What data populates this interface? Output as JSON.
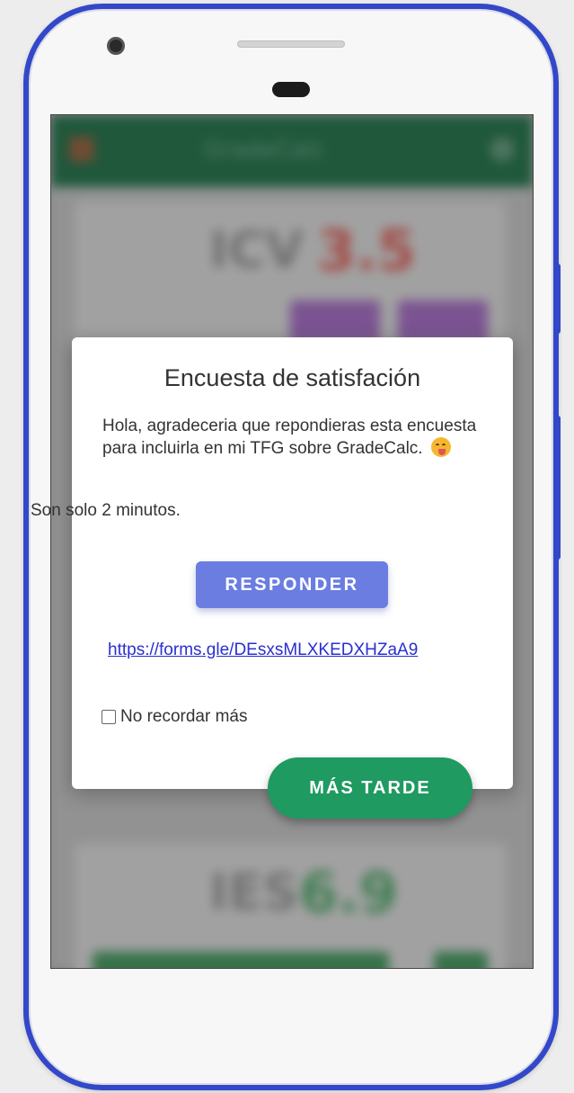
{
  "app": {
    "title": "GradeCalc",
    "card1": {
      "label": "ICV",
      "value": "3.5"
    },
    "card2": {
      "label": "IES",
      "value": "6.9"
    }
  },
  "dialog": {
    "title": "Encuesta de satisfación",
    "body": "Hola, agradeceria que repondieras esta encuesta para incluirla en mi TFG sobre GradeCalc.",
    "emoji": "yum-face-icon",
    "subtext": "Son solo 2 minutos.",
    "respond_button": "RESPONDER",
    "link": "https://forms.gle/DEsxsMLXKEDXHZaA9",
    "checkbox_label": "No recordar más",
    "checkbox_checked": false,
    "later_button": "MÁS TARDE"
  },
  "colors": {
    "frame": "#3347c9",
    "respond": "#6b7de0",
    "later": "#1f9a61",
    "link": "#2a2fd0"
  }
}
